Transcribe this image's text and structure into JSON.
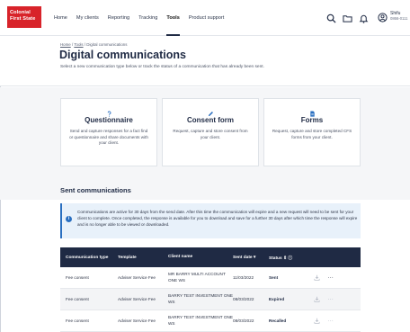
{
  "brand": {
    "line1": "Colonial",
    "line2": "First State",
    "color": "#d8232a"
  },
  "nav": {
    "items": [
      {
        "label": "Home",
        "active": false
      },
      {
        "label": "My clients",
        "active": false
      },
      {
        "label": "Reporting",
        "active": false
      },
      {
        "label": "Tracking",
        "active": false
      },
      {
        "label": "Tools",
        "active": true
      },
      {
        "label": "Product support",
        "active": false
      }
    ],
    "icons": [
      "search-icon",
      "folder-icon",
      "bell-icon",
      "user-icon"
    ]
  },
  "user": {
    "name": "Shifu",
    "id": "0866-0111"
  },
  "breadcrumb": {
    "home": "Home",
    "sep1": "/",
    "tools": "Tools",
    "sep2": "/",
    "current": "Digital communications"
  },
  "page": {
    "title": "Digital communications",
    "subtitle": "Select a new communication type below or track the status of a communication that has already been sent."
  },
  "cards": [
    {
      "icon": "question-icon",
      "title": "Questionnaire",
      "desc": "Send and capture responses for a fact find or questionnaire and share documents with your client."
    },
    {
      "icon": "pen-icon",
      "title": "Consent form",
      "desc": "Request, capture and store consent from your client."
    },
    {
      "icon": "document-icon",
      "title": "Forms",
      "desc": "Request, capture and store completed CFS forms from your client."
    }
  ],
  "sent": {
    "title": "Sent communications",
    "info": "Communications are active for 30 days from the send date. After this time the communication will expire and a new request will need to be sent for your client to complete. Once completed, the response is available for you to download and save for a further 30 days after which time the response will expire and is no longer able to be viewed or downloaded."
  },
  "table": {
    "headers": [
      "Communication type",
      "Template",
      "Client name",
      "Sent date ▾",
      "Status ⇕ ⓘ"
    ],
    "rows": [
      {
        "type": "Fee consent",
        "template": "Adviser Service Fee",
        "client": "MR BARRY MULTI ACCOUNT ONE WS",
        "date": "11/03/2022",
        "status": "Sent"
      },
      {
        "type": "Fee consent",
        "template": "Adviser Service Fee",
        "client": "BARRY TEST INVESTMENT ONE WS",
        "date": "08/03/2022",
        "status": "Expired"
      },
      {
        "type": "Fee consent",
        "template": "Adviser Service Fee",
        "client": "BARRY TEST INVESTMENT ONE WS",
        "date": "08/03/2022",
        "status": "Recalled"
      }
    ],
    "more": "···"
  },
  "colors": {
    "accent": "#1f2a44",
    "info_bg": "#e8f1fa",
    "info_border": "#2a6fc0"
  }
}
